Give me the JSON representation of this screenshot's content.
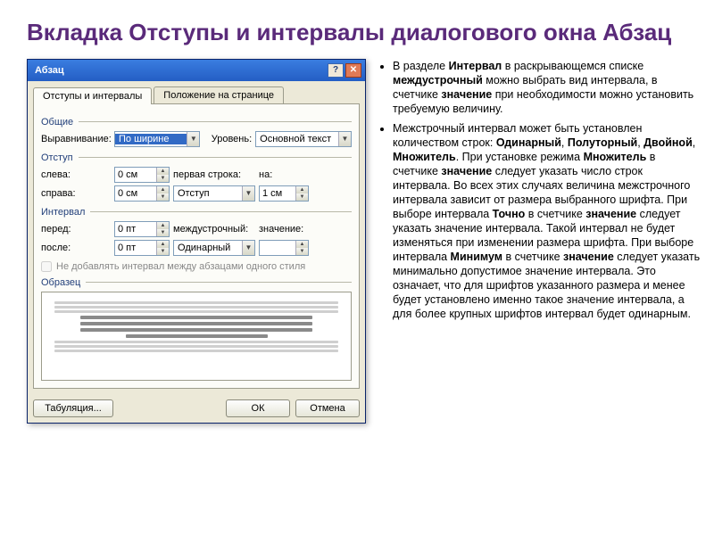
{
  "slide": {
    "title": "Вкладка Отступы и интервалы диалогового окна Абзац"
  },
  "bullets": [
    "В разделе <b>Интервал</b> в раскрывающемся списке <b>междустрочный</b> можно выбрать вид интервала, в счетчике <b>значение</b> при необходимости можно установить требуемую величину.",
    "Межстрочный интервал может быть установлен количеством строк: <b>Одинарный</b>, <b>Полуторный</b>, <b>Двойной</b>, <b>Множитель</b>. При установке режима <b>Множитель</b> в счетчике <b>значение</b> следует указать число строк интервала. Во всех этих случаях величина межстрочного интервала зависит от размера выбранного шрифта. При выборе интервала <b>Точно</b> в счетчике <b>значение</b> следует указать значение интервала. Такой интервал не будет изменяться при изменении размера шрифта. При выборе интервала <b>Минимум</b> в счетчике <b>значение</b> следует указать минимально допустимое значение интервала. Это означает, что для шрифтов указанного размера и менее будет установлено именно такое значение интервала, а для более крупных шрифтов интервал будет одинарным."
  ],
  "dialog": {
    "title": "Абзац",
    "help_icon": "?",
    "close_icon": "✕",
    "tabs": {
      "active": "Отступы и интервалы",
      "other": "Положение на странице"
    },
    "groups": {
      "general": "Общие",
      "indent": "Отступ",
      "spacing": "Интервал",
      "preview": "Образец"
    },
    "general": {
      "align_label": "Выравнивание:",
      "align_value": "По ширине",
      "level_label": "Уровень:",
      "level_value": "Основной текст"
    },
    "indent": {
      "left_label": "слева:",
      "left_value": "0 см",
      "right_label": "справа:",
      "right_value": "0 см",
      "firstline_label": "первая строка:",
      "firstline_value": "Отступ",
      "by_label": "на:",
      "by_value": "1 см"
    },
    "spacing": {
      "before_label": "перед:",
      "before_value": "0 пт",
      "after_label": "после:",
      "after_value": "0 пт",
      "linespace_label": "междустрочный:",
      "linespace_value": "Одинарный",
      "at_label": "значение:",
      "at_value": ""
    },
    "checkbox": "Не добавлять интервал между абзацами одного стиля",
    "buttons": {
      "tabs": "Табуляция...",
      "ok": "ОК",
      "cancel": "Отмена"
    }
  }
}
